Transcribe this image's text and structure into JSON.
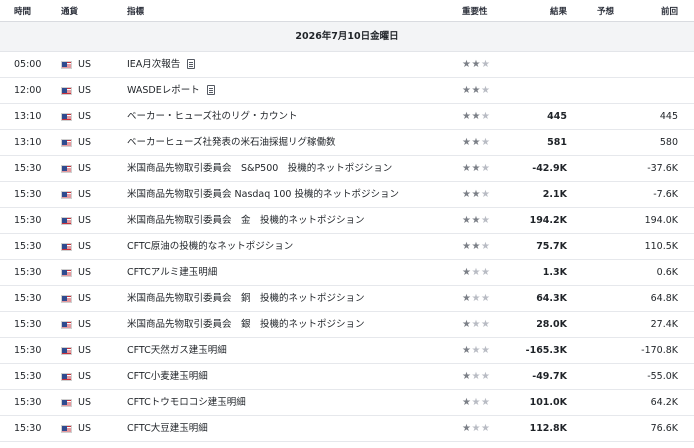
{
  "header": {
    "time": "時間",
    "currency": "通貨",
    "indicator": "指標",
    "importance": "重要性",
    "actual": "結果",
    "forecast": "予想",
    "previous": "前回"
  },
  "date_label": "2026年7月10日金曜日",
  "rows": [
    {
      "time": "05:00",
      "currency": "US",
      "name": "IEA月次報告",
      "doc": true,
      "stars": 2,
      "actual": "",
      "forecast": "",
      "previous": ""
    },
    {
      "time": "12:00",
      "currency": "US",
      "name": "WASDEレポート",
      "doc": true,
      "stars": 2,
      "actual": "",
      "forecast": "",
      "previous": ""
    },
    {
      "time": "13:10",
      "currency": "US",
      "name": "ベーカー・ヒューズ社のリグ・カウント",
      "doc": false,
      "stars": 2,
      "actual": "445",
      "forecast": "",
      "previous": "445"
    },
    {
      "time": "13:10",
      "currency": "US",
      "name": "ベーカーヒューズ社発表の米石油採掘リグ稼働数",
      "doc": false,
      "stars": 2,
      "actual": "581",
      "forecast": "",
      "previous": "580"
    },
    {
      "time": "15:30",
      "currency": "US",
      "name": "米国商品先物取引委員会　S&P500　投機的ネットポジション",
      "doc": false,
      "stars": 2,
      "actual": "-42.9K",
      "forecast": "",
      "previous": "-37.6K"
    },
    {
      "time": "15:30",
      "currency": "US",
      "name": "米国商品先物取引委員会 Nasdaq 100 投機的ネットポジション",
      "doc": false,
      "stars": 2,
      "actual": "2.1K",
      "forecast": "",
      "previous": "-7.6K"
    },
    {
      "time": "15:30",
      "currency": "US",
      "name": "米国商品先物取引委員会　金　投機的ネットポジション",
      "doc": false,
      "stars": 2,
      "actual": "194.2K",
      "forecast": "",
      "previous": "194.0K"
    },
    {
      "time": "15:30",
      "currency": "US",
      "name": "CFTC原油の投機的なネットポジション",
      "doc": false,
      "stars": 2,
      "actual": "75.7K",
      "forecast": "",
      "previous": "110.5K"
    },
    {
      "time": "15:30",
      "currency": "US",
      "name": "CFTCアルミ建玉明細",
      "doc": false,
      "stars": 1,
      "actual": "1.3K",
      "forecast": "",
      "previous": "0.6K"
    },
    {
      "time": "15:30",
      "currency": "US",
      "name": "米国商品先物取引委員会　銅　投機的ネットポジション",
      "doc": false,
      "stars": 1,
      "actual": "64.3K",
      "forecast": "",
      "previous": "64.8K"
    },
    {
      "time": "15:30",
      "currency": "US",
      "name": "米国商品先物取引委員会　銀　投機的ネットポジション",
      "doc": false,
      "stars": 1,
      "actual": "28.0K",
      "forecast": "",
      "previous": "27.4K"
    },
    {
      "time": "15:30",
      "currency": "US",
      "name": "CFTC天然ガス建玉明細",
      "doc": false,
      "stars": 1,
      "actual": "-165.3K",
      "forecast": "",
      "previous": "-170.8K"
    },
    {
      "time": "15:30",
      "currency": "US",
      "name": "CFTC小麦建玉明細",
      "doc": false,
      "stars": 1,
      "actual": "-49.7K",
      "forecast": "",
      "previous": "-55.0K"
    },
    {
      "time": "15:30",
      "currency": "US",
      "name": "CFTCトウモロコシ建玉明細",
      "doc": false,
      "stars": 1,
      "actual": "101.0K",
      "forecast": "",
      "previous": "64.2K"
    },
    {
      "time": "15:30",
      "currency": "US",
      "name": "CFTC大豆建玉明細",
      "doc": false,
      "stars": 1,
      "actual": "112.8K",
      "forecast": "",
      "previous": "76.6K"
    }
  ]
}
